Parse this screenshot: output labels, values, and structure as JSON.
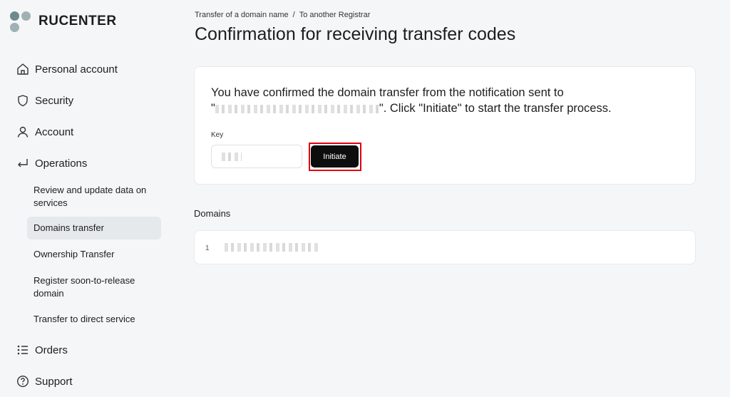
{
  "brand": {
    "name": "RUCENTER"
  },
  "sidebar": {
    "items": [
      {
        "label": "Personal account",
        "icon": "home-icon"
      },
      {
        "label": "Security",
        "icon": "shield-icon"
      },
      {
        "label": "Account",
        "icon": "user-icon"
      },
      {
        "label": "Operations",
        "icon": "return-arrow-icon"
      },
      {
        "label": "Orders",
        "icon": "list-icon"
      },
      {
        "label": "Support",
        "icon": "help-circle-icon"
      }
    ],
    "operations_sub": [
      {
        "label": "Review and update data on services"
      },
      {
        "label": "Domains transfer",
        "active": true
      },
      {
        "label": "Ownership Transfer"
      },
      {
        "label": "Register soon-to-release domain"
      },
      {
        "label": "Transfer to direct service"
      }
    ]
  },
  "breadcrumb": {
    "items": [
      "Transfer of a domain name",
      "To another Registrar"
    ],
    "separator": "/"
  },
  "page": {
    "title": "Confirmation for receiving transfer codes"
  },
  "confirm_card": {
    "message_part1": "You have confirmed the domain transfer from the notification sent to",
    "message_quote_open": "\"",
    "message_part2": "\". Click \"Initiate\" to start the transfer process.",
    "key_label": "Key",
    "initiate_label": "Initiate",
    "highlight_color": "#e0000f"
  },
  "domains": {
    "title": "Domains",
    "rows": [
      {
        "index": "1"
      }
    ]
  }
}
